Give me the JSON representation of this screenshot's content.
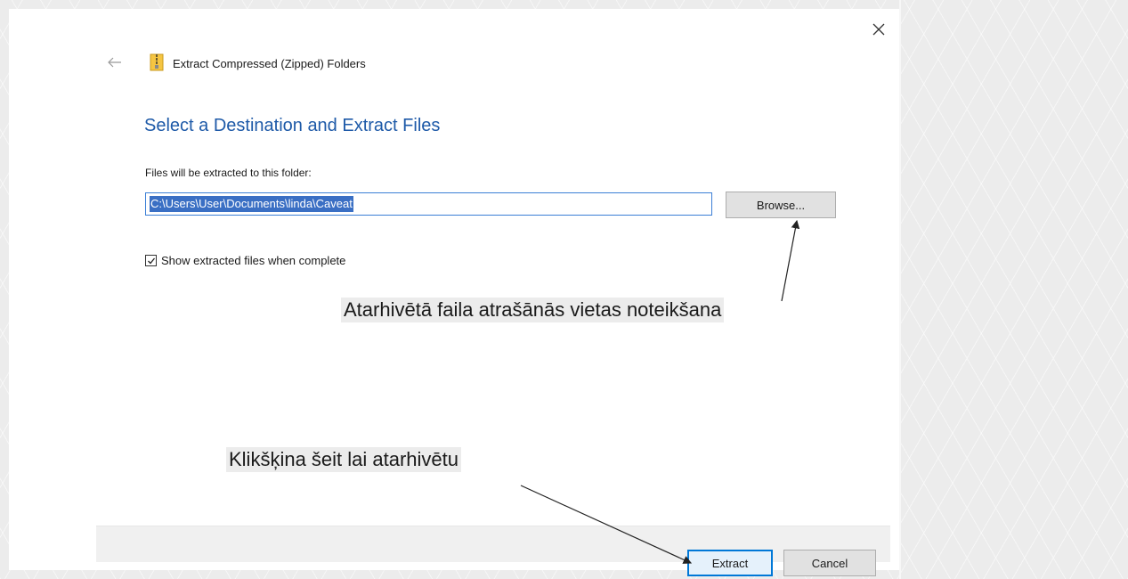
{
  "dialog": {
    "header_title": "Extract Compressed (Zipped) Folders",
    "subtitle": "Select a Destination and Extract Files",
    "folder_label": "Files will be extracted to this folder:",
    "path_value": "C:\\Users\\User\\Documents\\linda\\Caveat",
    "browse_label": "Browse...",
    "show_files_label": "Show extracted files when complete",
    "show_files_checked": true,
    "extract_label": "Extract",
    "cancel_label": "Cancel"
  },
  "annotations": {
    "browse_note": "Atarhivētā faila atrašānās vietas noteikšana",
    "extract_note": "Klikšķina šeit lai atarhivētu"
  },
  "icons": {
    "close": "close-icon",
    "back": "back-arrow-icon",
    "zip": "zip-folder-icon",
    "checkbox": "checkmark-icon"
  },
  "colors": {
    "accent": "#0078d7",
    "title_blue": "#1e5aa8",
    "selection": "#3a6fc4"
  }
}
